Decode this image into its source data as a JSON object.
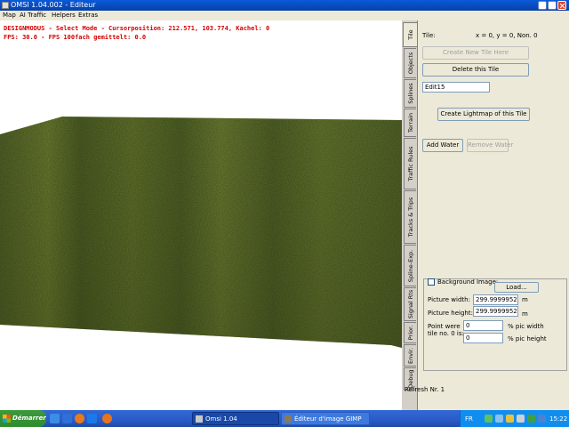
{
  "window": {
    "title": "OMSI 1.04.002 - Editeur"
  },
  "menu": [
    "Map",
    "AI Traffic",
    "Helpers",
    "Extras"
  ],
  "hud": {
    "line1": "DESIGNMODUS - Select Mode - Cursorposition: 212.571, 103.774, Kachel: 0",
    "line2": "FPS: 30.0 - FPS 100fach gemittelt: 0.0"
  },
  "tabs": [
    "Tile",
    "Objects",
    "Splines",
    "Terrain",
    "Traffic Rules",
    "Tracks & Trips",
    "Spline-Exp.",
    "Signal Rts",
    "Prior.",
    "Envir.",
    "Debug"
  ],
  "panel": {
    "tile_label": "Tile:",
    "tile_coords": "x = 0, y = 0, Non. 0",
    "create_new_tile": "Create New Tile Here",
    "delete_tile": "Delete this Tile",
    "tile_name_value": "Edit15",
    "create_lightmap": "Create Lightmap of this Tile",
    "add_water": "Add Water",
    "remove_water": "Remove Water",
    "background_image_label": "Background Image:",
    "load_button": "Load...",
    "picture_width_label": "Picture width:",
    "picture_width_value": "299.999995292",
    "picture_width_unit": "m",
    "picture_height_label": "Picture height:",
    "picture_height_value": "299.999995292",
    "picture_height_unit": "m",
    "point_label_1": "Point were",
    "point_label_2": "tile no. 0 is:",
    "point_x_value": "0",
    "point_x_unit": "% pic width",
    "point_y_value": "0",
    "point_y_unit": "% pic height",
    "refresh": "Refresh Nr. 1"
  },
  "taskbar": {
    "start": "Démarrer",
    "tasks": [
      "Omsi 1.04",
      "Éditeur d'image GIMP"
    ],
    "lang": "FR",
    "clock": "15:22"
  },
  "colors": {
    "hud": "#d40000",
    "taskbar": "#2a5bc8",
    "start": "#2e8b2e",
    "terrain": "#5a6a2a"
  }
}
